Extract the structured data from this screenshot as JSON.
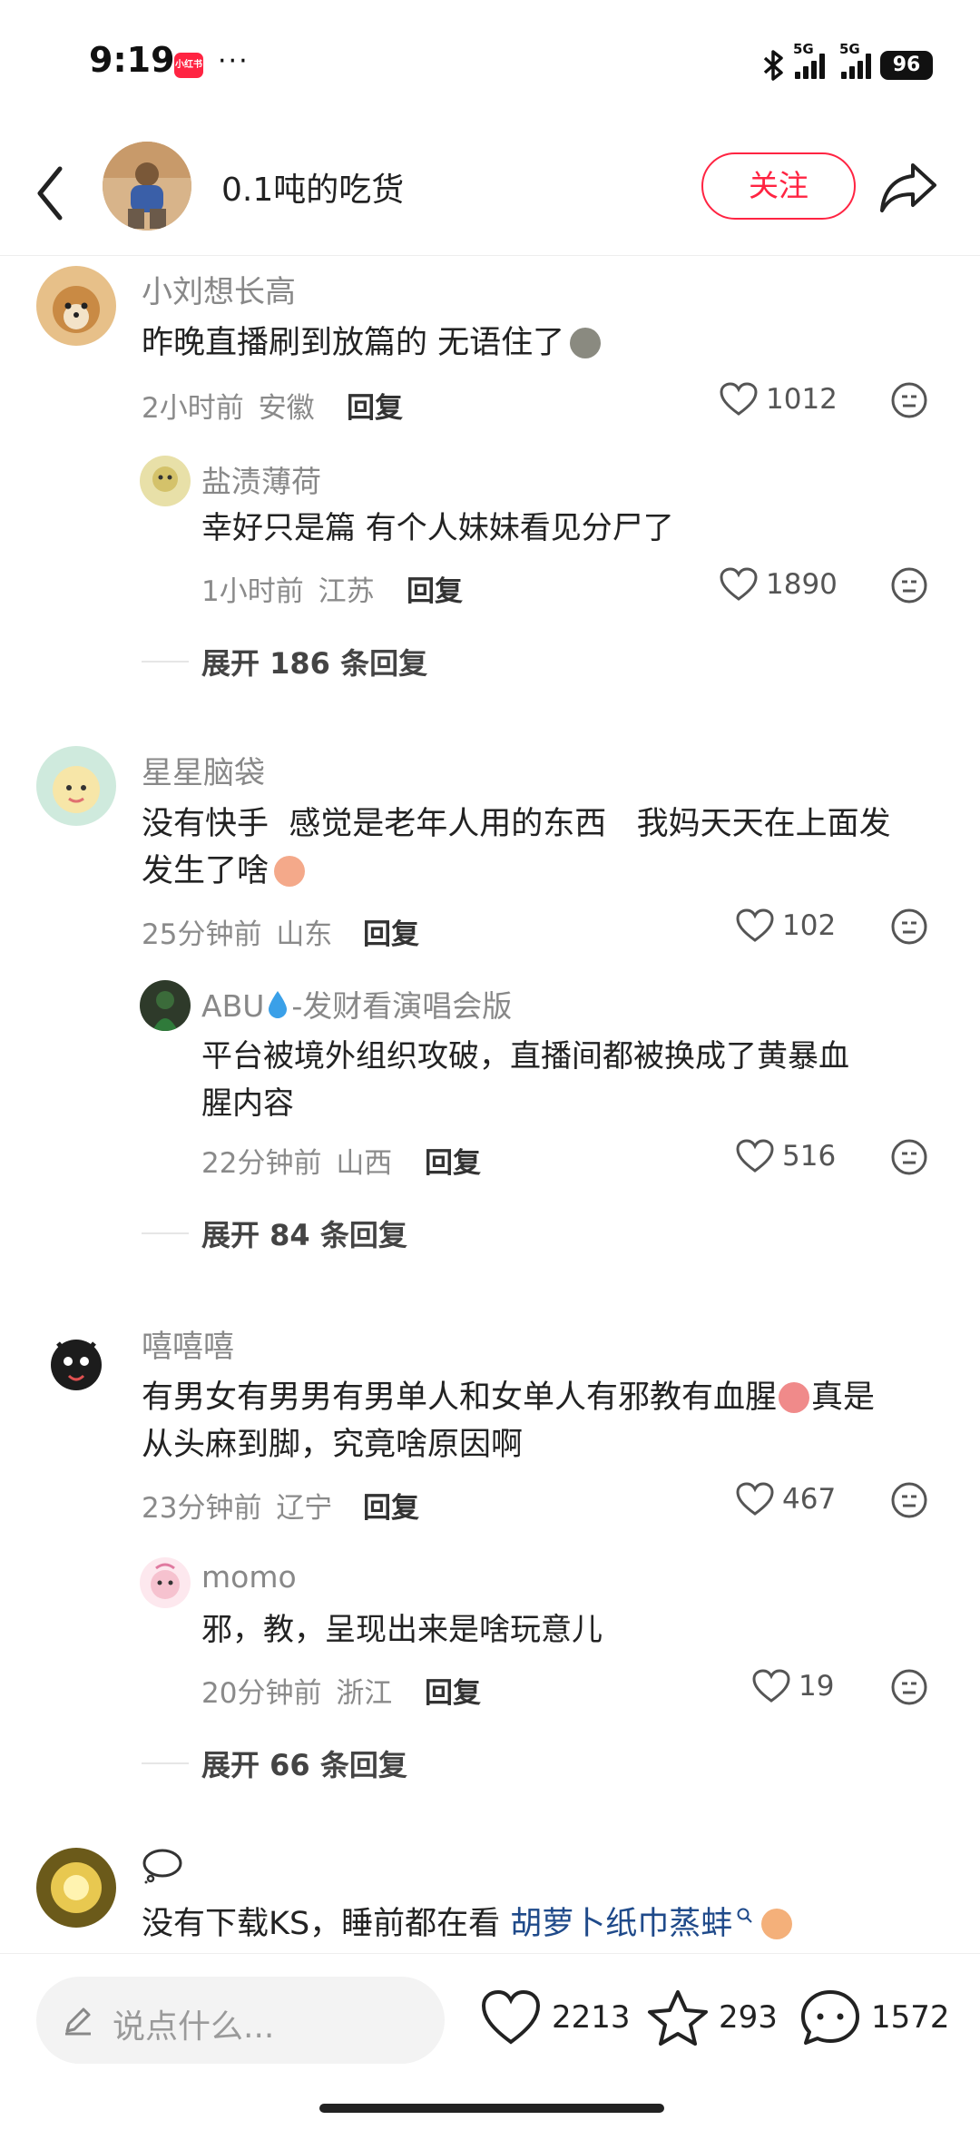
{
  "status_bar": {
    "time": "9:19",
    "app_badge": "小红书",
    "dots": "···",
    "signal1": "5G",
    "signal2": "5G",
    "battery": "96"
  },
  "header": {
    "title": "0.1吨的吃货",
    "follow": "关注"
  },
  "comments": [
    {
      "name": "小刘想长高",
      "text": "昨晚直播刷到放篇的 无语住了",
      "time": "2小时前",
      "location": "安徽",
      "reply": "回复",
      "likes": "1012",
      "sub": {
        "name": "盐渍薄荷",
        "text": "幸好只是篇 有个人妹妹看见分尸了",
        "time": "1小时前",
        "location": "江苏",
        "reply": "回复",
        "likes": "1890"
      },
      "expand": "展开 186 条回复"
    },
    {
      "name": "星星脑袋",
      "text_line1": "没有快手  感觉是老年人用的东西   我妈天天在上面发",
      "text_line2": "发生了啥",
      "time": "25分钟前",
      "location": "山东",
      "reply": "回复",
      "likes": "102",
      "sub": {
        "name_prefix": "ABU",
        "name_suffix": "-发财看演唱会版",
        "text_line1": "平台被境外组织攻破，直播间都被换成了黄暴血",
        "text_line2": "腥内容",
        "time": "22分钟前",
        "location": "山西",
        "reply": "回复",
        "likes": "516"
      },
      "expand": "展开 84 条回复"
    },
    {
      "name": "嘻嘻嘻",
      "text_line1": "有男女有男男有男单人和女单人有邪教有血腥",
      "text_line1_tail": "真是",
      "text_line2": "从头麻到脚，究竟啥原因啊",
      "time": "23分钟前",
      "location": "辽宁",
      "reply": "回复",
      "likes": "467",
      "sub": {
        "name": "momo",
        "text": "邪，教，呈现出来是啥玩意儿",
        "time": "20分钟前",
        "location": "浙江",
        "reply": "回复",
        "likes": "19"
      },
      "expand": "展开 66 条回复"
    },
    {
      "text_prefix": "没有下载KS，睡前都在看 ",
      "link": "胡萝卜纸巾蒸蚌"
    }
  ],
  "bottom": {
    "placeholder": "说点什么...",
    "likes": "2213",
    "stars": "293",
    "comments": "1572"
  },
  "colors": {
    "accent": "#ff2442",
    "link": "#1f4a8a"
  }
}
